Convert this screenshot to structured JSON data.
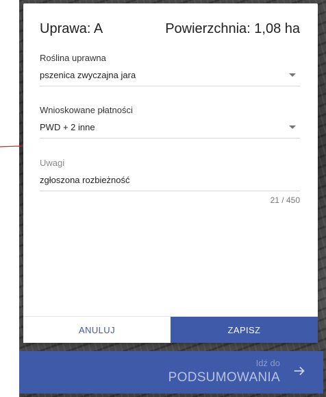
{
  "dialog": {
    "title": "Uprawa: A",
    "area": "Powierzchnia: 1,08 ha",
    "fields": {
      "crop": {
        "label": "Roślina uprawna",
        "value": "pszenica zwyczajna jara"
      },
      "payments": {
        "label": "Wnioskowane płatności",
        "value": "PWD + 2 inne"
      },
      "notes": {
        "label": "Uwagi",
        "value": "zgłoszona rozbieżność",
        "counter": "21 / 450"
      }
    },
    "actions": {
      "cancel": "ANULUJ",
      "save": "ZAPISZ"
    }
  },
  "bottom_bar": {
    "go_to": "Idź do",
    "destination": "PODSUMOWANIA"
  },
  "colors": {
    "accent": "#3e5aa8",
    "annotation": "#e0231b"
  },
  "icons": {
    "dropdown": "caret-down-icon",
    "next": "arrow-right-icon"
  }
}
